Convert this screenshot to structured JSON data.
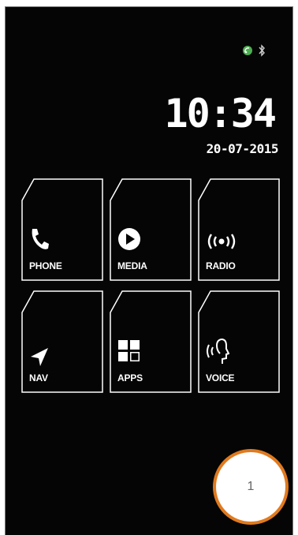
{
  "status": {
    "icons": [
      "signal-icon",
      "bluetooth-icon"
    ]
  },
  "clock": {
    "time": "10:34",
    "date": "20-07-2015"
  },
  "tiles": [
    {
      "label": "PHONE",
      "icon": "phone-icon"
    },
    {
      "label": "MEDIA",
      "icon": "play-icon"
    },
    {
      "label": "RADIO",
      "icon": "radio-waves-icon"
    },
    {
      "label": "NAV",
      "icon": "navigation-arrow-icon"
    },
    {
      "label": "APPS",
      "icon": "apps-grid-icon"
    },
    {
      "label": "VOICE",
      "icon": "voice-icon"
    }
  ],
  "marker": {
    "label": "1"
  },
  "colors": {
    "background": "#050505",
    "tile_outline": "#ffffff",
    "marker_ring": "#e07a1f"
  }
}
